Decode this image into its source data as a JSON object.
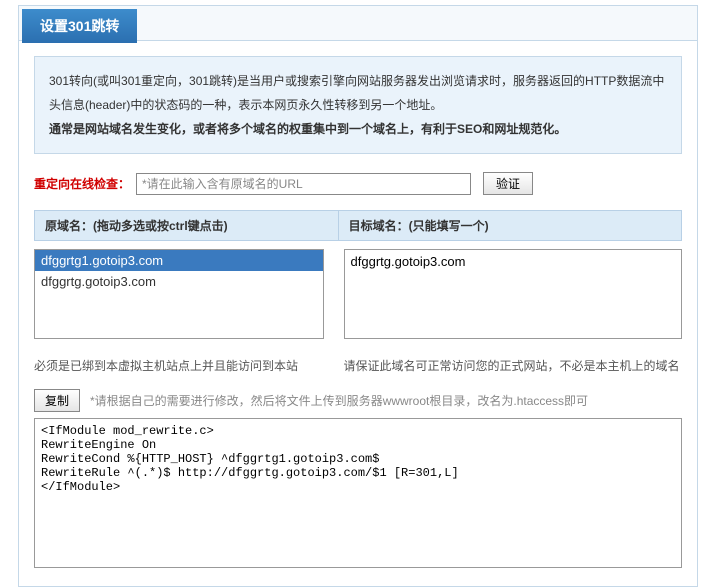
{
  "header": {
    "tab_title": "设置301跳转"
  },
  "intro": {
    "line1": "301转向(或叫301重定向，301跳转)是当用户或搜索引擎向网站服务器发出浏览请求时，服务器返回的HTTP数据流中头信息(header)中的状态码的一种，表示本网页永久性转移到另一个地址。",
    "line2": "通常是网站域名发生变化，或者将多个域名的权重集中到一个域名上，有利于SEO和网址规范化。"
  },
  "check": {
    "label": "重定向在线检查：",
    "placeholder": "*请在此输入含有原域名的URL",
    "verify_label": "验证"
  },
  "columns": {
    "source_header": "原域名：(拖动多选或按ctrl键点击)",
    "target_header": "目标域名：(只能填写一个)",
    "source_items": [
      {
        "text": "dfggrtg1.gotoip3.com",
        "selected": true
      },
      {
        "text": "dfggrtg.gotoip3.com",
        "selected": false
      }
    ],
    "target_value": "dfggrtg.gotoip3.com",
    "source_note": "必须是已绑到本虚拟主机站点上并且能访问到本站",
    "target_note": "请保证此域名可正常访问您的正式网站，不必是本主机上的域名"
  },
  "copy": {
    "button_label": "复制",
    "note": "*请根据自己的需要进行修改，然后将文件上传到服务器wwwroot根目录，改名为.htaccess即可"
  },
  "code": {
    "content": "<IfModule mod_rewrite.c>\nRewriteEngine On\nRewriteCond %{HTTP_HOST} ^dfggrtg1.gotoip3.com$\nRewriteRule ^(.*)$ http://dfggrtg.gotoip3.com/$1 [R=301,L]\n</IfModule>"
  }
}
